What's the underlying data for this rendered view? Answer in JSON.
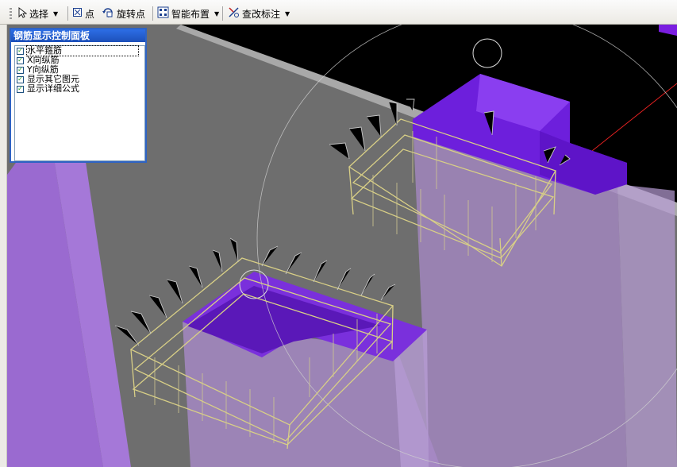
{
  "toolbar": {
    "select": {
      "label": "选择",
      "icon": "cursor-arrow-icon"
    },
    "point": {
      "label": "点",
      "icon": "point-box-icon"
    },
    "rotate_point": {
      "label": "旋转点",
      "icon": "rotate-point-icon"
    },
    "smart_layout": {
      "label": "智能布置",
      "icon": "smart-layout-icon"
    },
    "edit_annotation": {
      "label": "查改标注",
      "icon": "edit-annotation-icon"
    }
  },
  "rebar_panel": {
    "title": "钢筋显示控制面板",
    "items": [
      {
        "label": "水平箍筋",
        "checked": true
      },
      {
        "label": "X向纵筋",
        "checked": true
      },
      {
        "label": "Y向纵筋",
        "checked": true
      },
      {
        "label": "显示其它图元",
        "checked": true
      },
      {
        "label": "显示详细公式",
        "checked": true
      }
    ]
  },
  "viewport": {
    "colors": {
      "background": "#000000",
      "slab": "#6e6e6e",
      "slab_edge": "#a8a8a8",
      "column": "#8a5ac4",
      "column_top": "#6a22d8",
      "rebar": "#d8cf86",
      "stirrup_ends": "#c8c8c8",
      "axis_line": "#e02020"
    }
  }
}
